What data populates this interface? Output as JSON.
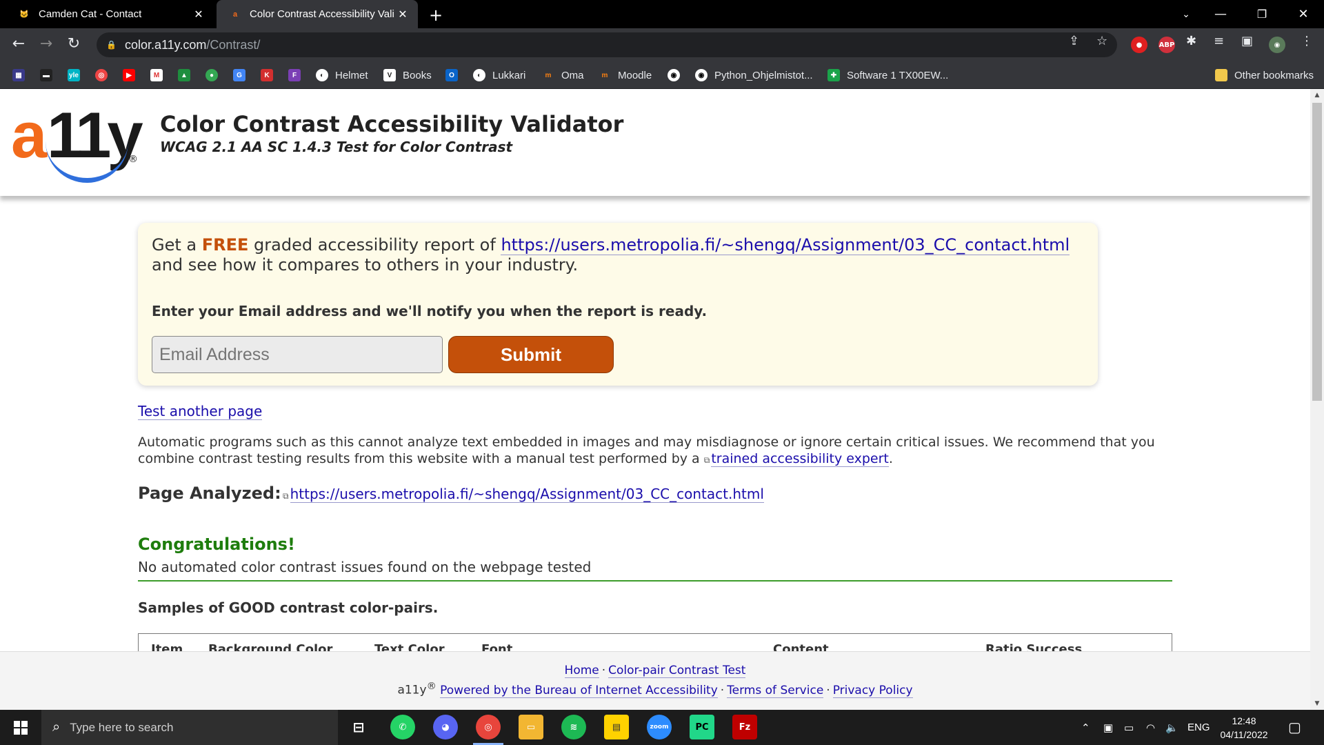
{
  "browser": {
    "tabs": [
      {
        "title": "Camden Cat - Contact",
        "active": false,
        "favicon": "cat-icon"
      },
      {
        "title": "Color Contrast Accessibility Valid",
        "active": true,
        "favicon": "a11y-icon"
      }
    ],
    "url_host": "color.a11y.com",
    "url_path": "/Contrast/",
    "bookmarks": [
      {
        "label": "Helmet",
        "icon": "helmet-icon"
      },
      {
        "label": "Books",
        "icon": "books-icon"
      },
      {
        "label": "Lukkari",
        "icon": "lukkari-icon"
      },
      {
        "label": "Oma",
        "icon": "oma-icon"
      },
      {
        "label": "Moodle",
        "icon": "moodle-icon"
      },
      {
        "label": "Python_Ohjelmistot...",
        "icon": "github-icon"
      },
      {
        "label": "Software 1 TX00EW...",
        "icon": "plus-icon"
      }
    ],
    "other_bookmarks": "Other bookmarks",
    "extension_abp": "ABP"
  },
  "site": {
    "logo_a": "a",
    "logo_rest": "11y",
    "logo_reg": "®",
    "title": "Color Contrast Accessibility Validator",
    "subtitle": "WCAG 2.1 AA SC 1.4.3 Test for Color Contrast"
  },
  "promo": {
    "text_before": "Get a ",
    "free": "FREE",
    "text_after": " graded accessibility report of ",
    "url": "https://users.metropolia.fi/~shengq/Assignment/03_CC_contact.html",
    "text_line2": "and see how it compares to others in your industry.",
    "email_label": "Enter your Email address and we'll notify you when the report is ready.",
    "email_placeholder": "Email Address",
    "submit_label": "Submit"
  },
  "content": {
    "test_another": "Test another page",
    "disclaimer": "Automatic programs such as this cannot analyze text embedded in images and may misdiagnose or ignore certain critical issues. We recommend that you combine contrast testing results from this website with a manual test performed by a ",
    "expert_link": "trained accessibility expert",
    "disclaimer_end": ".",
    "page_analyzed_label": "Page Analyzed:",
    "page_analyzed_url": "https://users.metropolia.fi/~shengq/Assignment/03_CC_contact.html",
    "congrats_title": "Congratulations!",
    "congrats_text": "No automated color contrast issues found on the webpage tested",
    "samples_heading": "Samples of GOOD contrast color-pairs.",
    "table_headers": [
      "Item",
      "Background Color",
      "Text Color",
      "Font",
      "Content",
      "Ratio Success"
    ]
  },
  "footer": {
    "home": "Home",
    "color_pair": "Color-pair Contrast Test",
    "brand": "a11y",
    "brand_reg": "®",
    "powered": "Powered by the Bureau of Internet Accessibility",
    "terms": "Terms of Service",
    "privacy": "Privacy Policy"
  },
  "taskbar": {
    "search_placeholder": "Type here to search",
    "language": "ENG",
    "time": "12:48",
    "date": "04/11/2022"
  },
  "colors": {
    "brand_orange": "#c4500a",
    "link_blue": "#1a0dab",
    "success_green": "#1e7d0d"
  }
}
